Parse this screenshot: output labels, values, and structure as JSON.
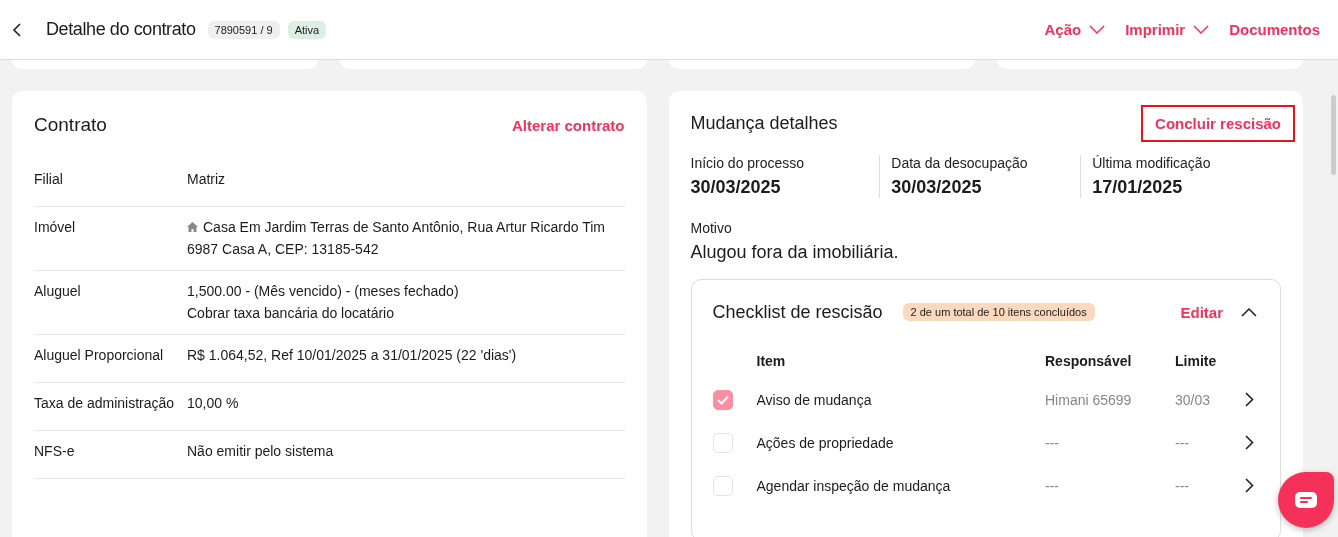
{
  "header": {
    "title": "Detalhe do contrato",
    "code": "7890591 / 9",
    "status": "Ativa",
    "actions": [
      {
        "label": "Ação",
        "dropdown": true
      },
      {
        "label": "Imprimir",
        "dropdown": true
      },
      {
        "label": "Documentos",
        "dropdown": false
      }
    ]
  },
  "contract": {
    "title": "Contrato",
    "action": "Alterar contrato",
    "rows": [
      {
        "label": "Filial",
        "lines": [
          "Matriz"
        ],
        "icon": false
      },
      {
        "label": "Imóvel",
        "lines": [
          "Casa Em Jardim Terras de Santo Antônio, Rua Artur Ricardo Tim 6987 Casa A, CEP: 13185-542"
        ],
        "icon": true
      },
      {
        "label": "Aluguel",
        "lines": [
          "1,500.00 - (Mês vencido) - (meses fechado)",
          "Cobrar taxa bancária do locatário"
        ],
        "icon": false
      },
      {
        "label": "Aluguel Proporcional",
        "lines": [
          "R$ 1.064,52, Ref 10/01/2025 a 31/01/2025 (22 'dias')"
        ],
        "icon": false
      },
      {
        "label": "Taxa de administração",
        "lines": [
          "10,00 %"
        ],
        "icon": false
      },
      {
        "label": "NFS-e",
        "lines": [
          "Não emitir pelo sistema"
        ],
        "icon": false
      }
    ]
  },
  "move": {
    "title": "Mudança detalhes",
    "action": "Concluir rescisão",
    "facts": [
      {
        "label": "Início do processo",
        "value": "30/03/2025"
      },
      {
        "label": "Data da desocupação",
        "value": "30/03/2025"
      },
      {
        "label": "Última modificação",
        "value": "17/01/2025"
      }
    ],
    "reason_label": "Motivo",
    "reason": "Alugou fora da imobiliária.",
    "checklist": {
      "title": "Checklist de rescisão",
      "progress": "2 de um total de 10 itens concluídos",
      "edit": "Editar",
      "expanded": true,
      "columns": [
        "Item",
        "Responsável",
        "Limite"
      ],
      "items": [
        {
          "name": "Aviso de mudança",
          "owner": "Himani 65699",
          "due": "30/03",
          "checked": true
        },
        {
          "name": "Ações de propriedade",
          "owner": "---",
          "due": "---",
          "checked": false
        },
        {
          "name": "Agendar inspeção de mudança",
          "owner": "---",
          "due": "---",
          "checked": false
        }
      ]
    }
  }
}
